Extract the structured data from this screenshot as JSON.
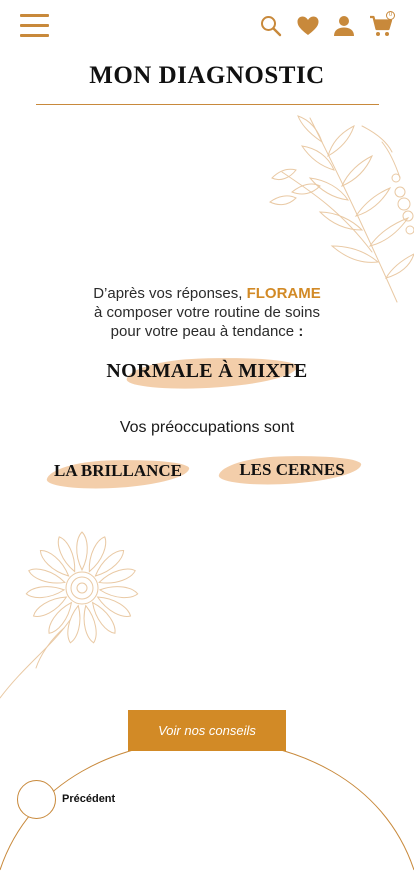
{
  "header": {
    "menu_icon": "hamburger-menu-icon",
    "search_icon": "search-icon",
    "wishlist_icon": "heart-icon",
    "account_icon": "user-icon",
    "cart_icon": "cart-icon",
    "cart_count": "0"
  },
  "page": {
    "title": "MON DIAGNOSTIC"
  },
  "result": {
    "intro_line1_prefix": "D’après vos réponses, ",
    "brand": "FLORAME",
    "intro_line2": "à composer votre routine de soins",
    "intro_line3": "pour votre peau à tendance ",
    "intro_colon": ":",
    "skin_type": "NORMALE À MIXTE",
    "concerns_heading": "Vos préoccupations sont",
    "concerns": [
      "LA BRILLANCE",
      "LES CERNES"
    ]
  },
  "actions": {
    "cta_label": "Voir nos conseils",
    "previous_label": "Précédent"
  },
  "colors": {
    "accent": "#d28a26",
    "line": "#c8893b",
    "highlight": "#f2c9a1"
  }
}
